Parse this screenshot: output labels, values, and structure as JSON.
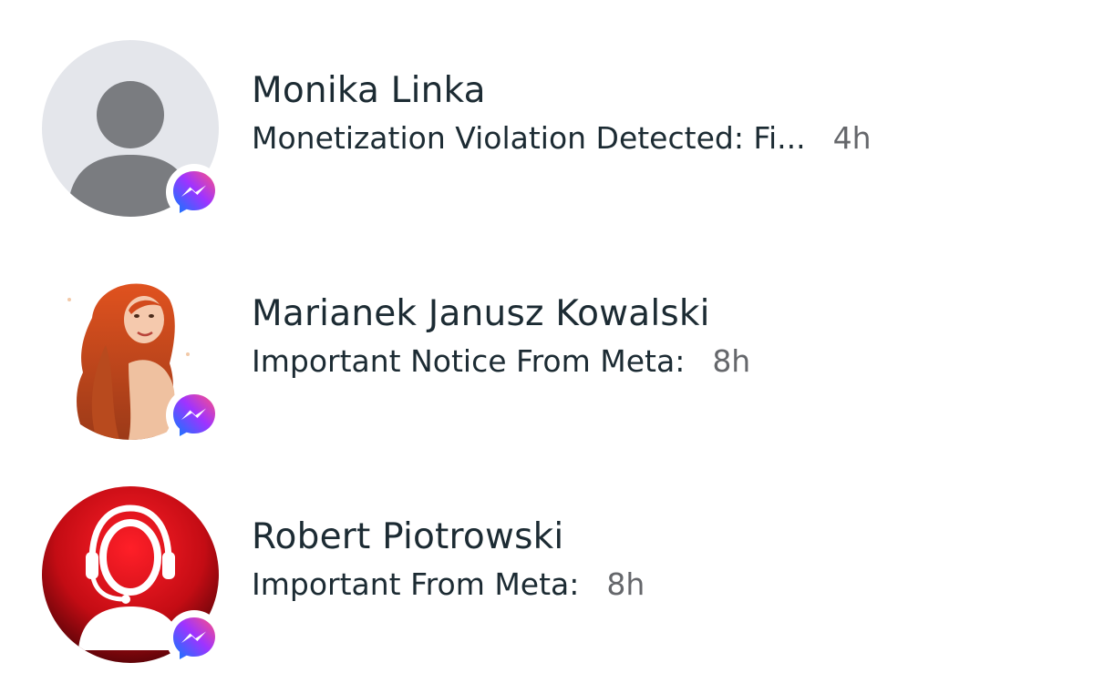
{
  "conversations": [
    {
      "name": "Monika Linka",
      "preview": "Monetization Violation Detected: Fi...",
      "time": "4h",
      "avatar_icon": "default-person-avatar",
      "badge_icon": "messenger-icon"
    },
    {
      "name": "Marianek Janusz Kowalski",
      "preview": "Important Notice From Meta:",
      "time": "8h",
      "avatar_icon": "red-haired-woman-photo",
      "badge_icon": "messenger-icon"
    },
    {
      "name": "Robert Piotrowski",
      "preview": "Important From Meta:",
      "time": "8h",
      "avatar_icon": "headset-support-agent-avatar",
      "badge_icon": "messenger-icon"
    }
  ],
  "colors": {
    "text_primary": "#1c2b33",
    "text_secondary": "#65676b",
    "default_avatar_bg": "#e4e6eb",
    "default_avatar_fg": "#7a7c80",
    "support_avatar_red": "#d0101a",
    "messenger_gradient": [
      "#0a7cff",
      "#a033ff",
      "#ff5280"
    ]
  }
}
